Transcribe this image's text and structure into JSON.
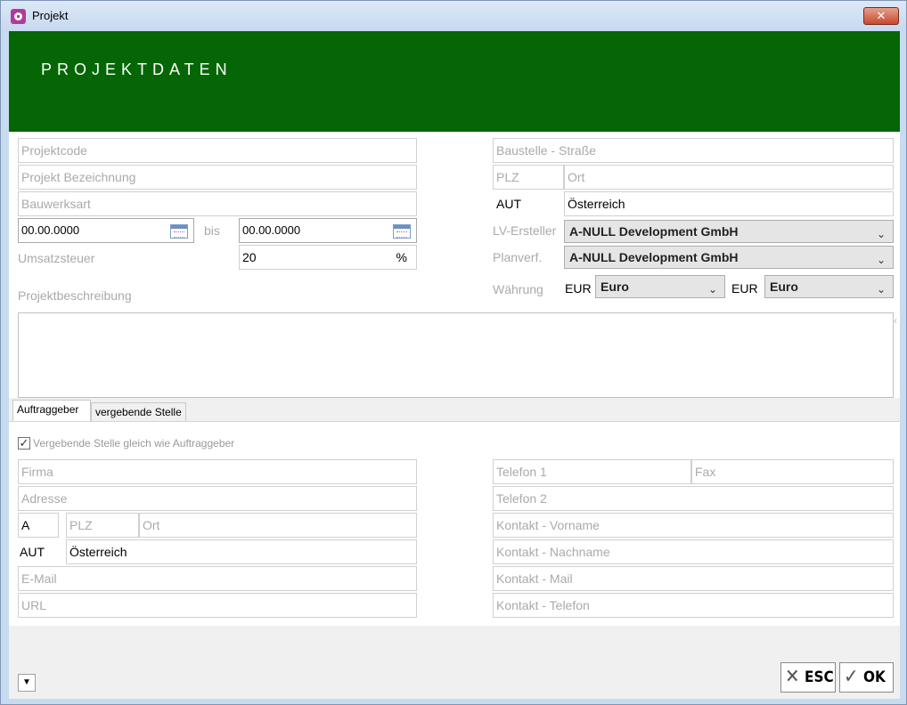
{
  "window": {
    "title": "Projekt",
    "close_label": "✕"
  },
  "header": {
    "title": "PROJEKTDATEN"
  },
  "project": {
    "code_placeholder": "Projektcode",
    "name_placeholder": "Projekt Bezeichnung",
    "building_type_placeholder": "Bauwerksart",
    "date_from": "00.00.0000",
    "date_between": "bis",
    "date_to": "00.00.0000",
    "vat_label": "Umsatzsteuer",
    "vat_value": "20",
    "vat_unit": "%",
    "description_label": "Projektbeschreibung",
    "site_street_placeholder": "Baustelle - Straße",
    "site_zip_placeholder": "PLZ",
    "site_city_placeholder": "Ort",
    "country_code": "AUT",
    "country_name": "Österreich",
    "lv_creator_label": "LV-Ersteller",
    "lv_creator_value": "A-NULL Development GmbH",
    "planner_label": "Planverf.",
    "planner_value": "A-NULL Development GmbH",
    "currency_label": "Währung",
    "currency1_code": "EUR",
    "currency1_value": "Euro",
    "currency2_code": "EUR",
    "currency2_value": "Euro"
  },
  "tabs": [
    {
      "label": "Auftraggeber",
      "active": true
    },
    {
      "label": "vergebende Stelle",
      "active": false
    }
  ],
  "client": {
    "same_as_label": "Vergebende Stelle gleich wie Auftraggeber",
    "same_as_checked": true,
    "checkmark": "✓",
    "company_placeholder": "Firma",
    "address_placeholder": "Adresse",
    "country_prefix": "A",
    "zip_placeholder": "PLZ",
    "city_placeholder": "Ort",
    "country_code": "AUT",
    "country_name": "Österreich",
    "email_placeholder": "E-Mail",
    "url_placeholder": "URL",
    "phone1_placeholder": "Telefon 1",
    "fax_placeholder": "Fax",
    "phone2_placeholder": "Telefon 2",
    "contact_first_placeholder": "Kontakt - Vorname",
    "contact_last_placeholder": "Kontakt - Nachname",
    "contact_mail_placeholder": "Kontakt - Mail",
    "contact_phone_placeholder": "Kontakt - Telefon"
  },
  "footer": {
    "menu_arrow": "▼",
    "esc_label": "ESC",
    "esc_icon": "✕",
    "ok_label": "OK",
    "ok_icon": "✓"
  },
  "icons": {
    "dropdown": "⌄",
    "colors": {
      "header_green": "#056605",
      "close_red": "#c44a2f",
      "app_icon": "#b23a9c"
    }
  }
}
